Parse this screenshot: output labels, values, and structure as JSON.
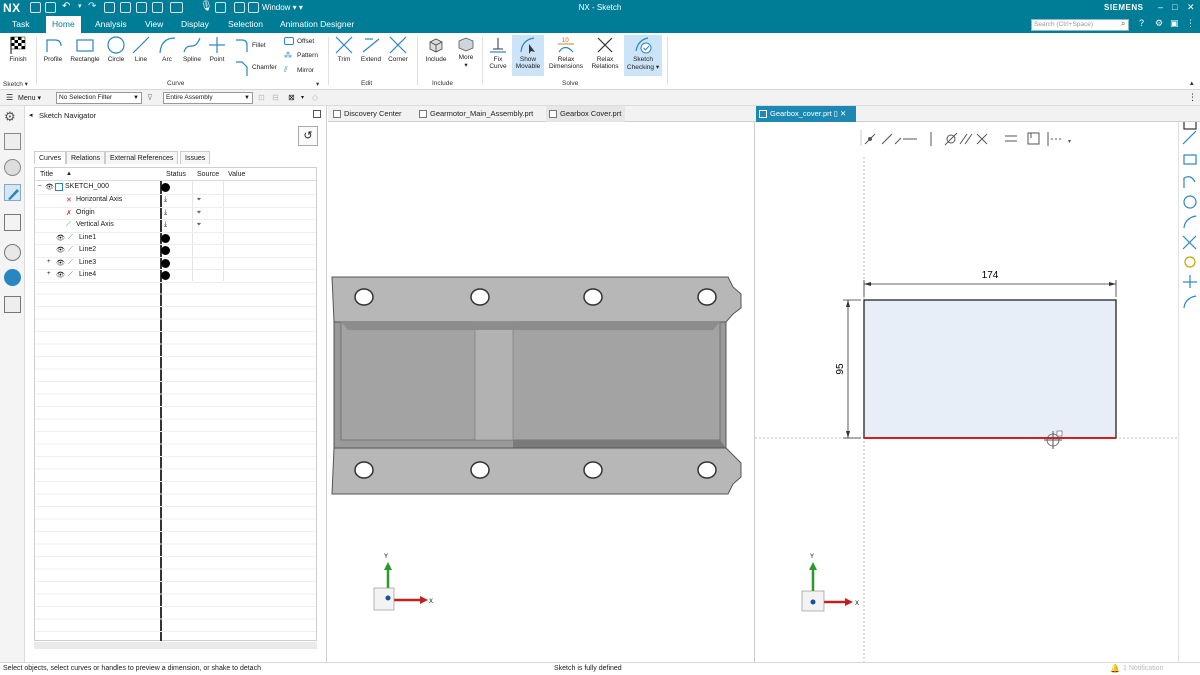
{
  "titlebar": {
    "logo": "NX",
    "window_menu": "Window",
    "title": "NX - Sketch",
    "brand": "SIEMENS",
    "controls": [
      "–",
      "□",
      "✕"
    ]
  },
  "menubar": {
    "tabs": [
      "Task",
      "Home",
      "Analysis",
      "View",
      "Display",
      "Selection",
      "Animation Designer"
    ],
    "active": "Home",
    "search_placeholder": "Search (Ctrl+Space)"
  },
  "ribbon": {
    "sketch_group": {
      "finish": "Finish",
      "name": "Sketch"
    },
    "curve_group": {
      "buttons": [
        "Profile",
        "Rectangle",
        "Circle",
        "Line",
        "Arc",
        "Spline",
        "Point"
      ],
      "fillet": "Fillet",
      "chamfer": "Chamfer",
      "offset": "Offset",
      "pattern": "Pattern",
      "mirror": "Mirror",
      "name": "Curve"
    },
    "edit_group": {
      "buttons": [
        "Trim",
        "Extend",
        "Corner"
      ],
      "name": "Edit"
    },
    "include_group": {
      "include": "Include",
      "more": "More",
      "name": "Include"
    },
    "solve_group": {
      "fix_curve_1": "Fix",
      "fix_curve_2": "Curve",
      "show_movable_1": "Show",
      "show_movable_2": "Movable",
      "relax_dims_1": "Relax",
      "relax_dims_2": "Dimensions",
      "relax_rel_1": "Relax",
      "relax_rel_2": "Relations",
      "sketch_check_1": "Sketch",
      "sketch_check_2": "Checking",
      "relax_badge": "10",
      "name": "Solve"
    }
  },
  "filterbar": {
    "menu": "Menu",
    "selection_filter": "No Selection Filter",
    "scope": "Entire Assembly"
  },
  "navigator": {
    "title": "Sketch Navigator",
    "tabs": [
      "Curves",
      "Relations",
      "External References",
      "Issues"
    ],
    "columns": [
      "Title",
      "Status",
      "Source",
      "Value"
    ],
    "rows": [
      {
        "title": "SKETCH_000",
        "status": "dot"
      },
      {
        "title": "Horizontal Axis",
        "status": "down"
      },
      {
        "title": "Origin",
        "status": "down"
      },
      {
        "title": "Vertical Axis",
        "status": "down"
      },
      {
        "title": "Line1",
        "status": "dot"
      },
      {
        "title": "Line2",
        "status": "dot"
      },
      {
        "title": "Line3",
        "status": "dot"
      },
      {
        "title": "Line4",
        "status": "dot"
      }
    ]
  },
  "tabs": {
    "left": [
      "Discovery Center",
      "Gearmotor_Main_Assembly.prt",
      "Gearbox Cover.prt"
    ],
    "right": "Gearbox_cover.prt"
  },
  "sketch": {
    "width_dim": "174",
    "height_dim": "95"
  },
  "triad": {
    "x": "X",
    "y": "Y"
  },
  "statusbar": {
    "left": "Select objects, select curves or handles to preview a dimension, or shake to detach",
    "center": "Sketch is fully defined",
    "notification": "1 Notification"
  },
  "colors": {
    "brand": "#007d96",
    "active_tab": "#1e88b4",
    "sketch_fill": "#e8eef8",
    "constraint_red": "#d22020",
    "axis_blue": "#1a4fa0"
  }
}
